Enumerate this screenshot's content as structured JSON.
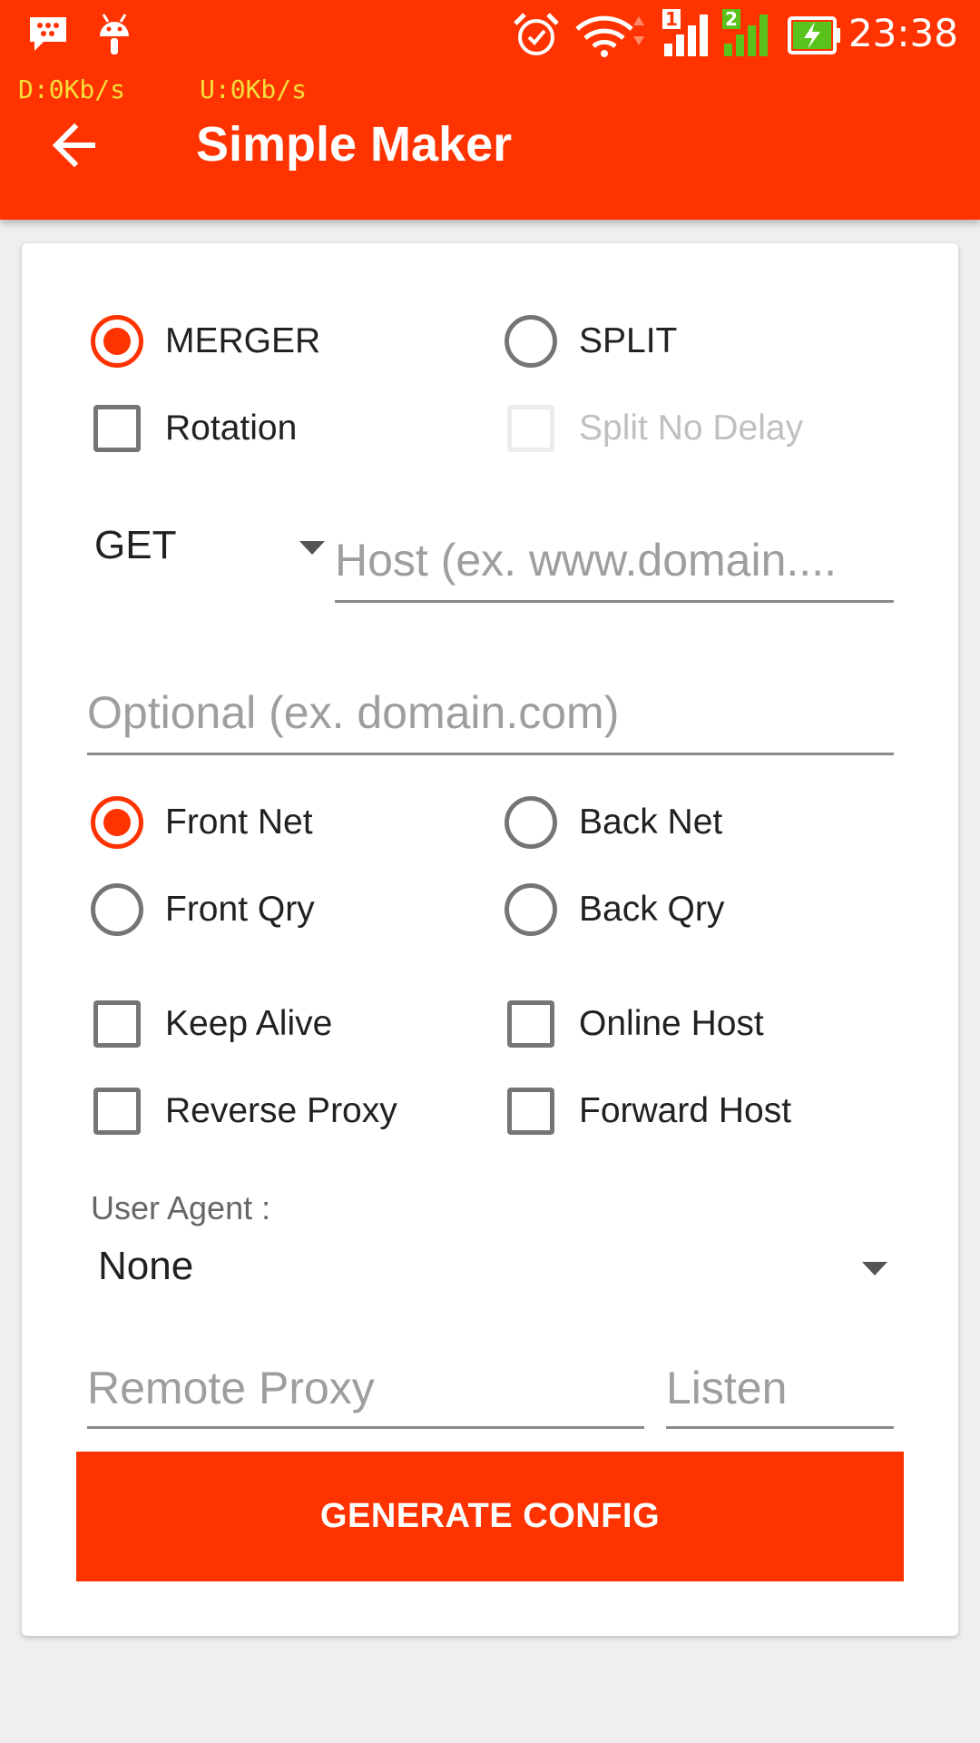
{
  "status_bar": {
    "time": "23:38",
    "download_speed": "D:0Kb/s",
    "upload_speed": "U:0Kb/s",
    "sim1_label": "1",
    "sim2_label": "2",
    "icons": [
      "bbm-icon",
      "android-icon",
      "alarm-icon",
      "wifi-icon",
      "signal-sim1-icon",
      "signal-sim2-icon",
      "battery-charging-icon"
    ]
  },
  "toolbar": {
    "title": "Simple Maker",
    "back_icon": "arrow-left-icon"
  },
  "mode": {
    "merger_label": "MERGER",
    "split_label": "SPLIT",
    "selected": "MERGER"
  },
  "options_top": {
    "rotation_label": "Rotation",
    "rotation_checked": false,
    "split_no_delay_label": "Split No Delay",
    "split_no_delay_enabled": false
  },
  "method": {
    "selected": "GET"
  },
  "host": {
    "placeholder": "Host (ex. www.domain....",
    "value": ""
  },
  "optional_host": {
    "placeholder": "Optional (ex. domain.com)",
    "value": ""
  },
  "injection": {
    "front_net_label": "Front Net",
    "back_net_label": "Back Net",
    "front_qry_label": "Front Qry",
    "back_qry_label": "Back Qry",
    "selected": "Front Net"
  },
  "flags": {
    "keep_alive_label": "Keep Alive",
    "online_host_label": "Online Host",
    "reverse_proxy_label": "Reverse Proxy",
    "forward_host_label": "Forward Host"
  },
  "user_agent": {
    "label": "User Agent :",
    "selected": "None"
  },
  "proxy": {
    "remote_placeholder": "Remote Proxy",
    "listen_placeholder": "Listen"
  },
  "actions": {
    "generate_label": "GENERATE CONFIG"
  },
  "colors": {
    "accent": "#ff3300",
    "background": "#efeff1",
    "speed_text": "#f3df3a"
  }
}
